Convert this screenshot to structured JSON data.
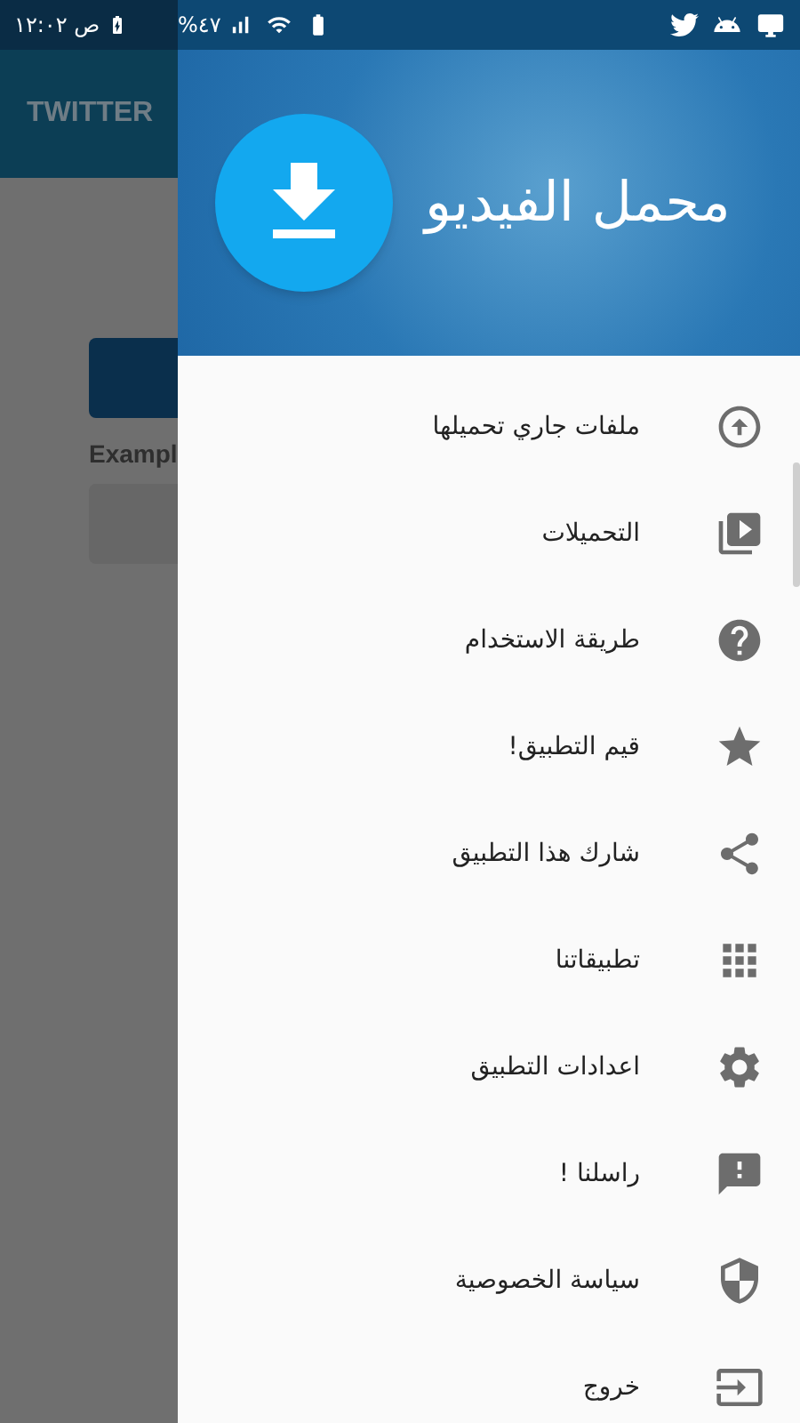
{
  "status_bar": {
    "time": "ص ١٢:٠٢",
    "battery": "%٤٧"
  },
  "background": {
    "app_title": "TWITTER",
    "field_label": "Exampl"
  },
  "drawer": {
    "title": "محمل الفيديو",
    "items": [
      {
        "label": "ملفات جاري تحميلها"
      },
      {
        "label": "التحميلات"
      },
      {
        "label": "طريقة الاستخدام"
      },
      {
        "label": "قيم التطبيق!"
      },
      {
        "label": "شارك هذا التطبيق"
      },
      {
        "label": "تطبيقاتنا"
      },
      {
        "label": "اعدادات التطبيق"
      },
      {
        "label": "راسلنا !"
      },
      {
        "label": "سياسة الخصوصية"
      },
      {
        "label": "خروج"
      }
    ]
  }
}
